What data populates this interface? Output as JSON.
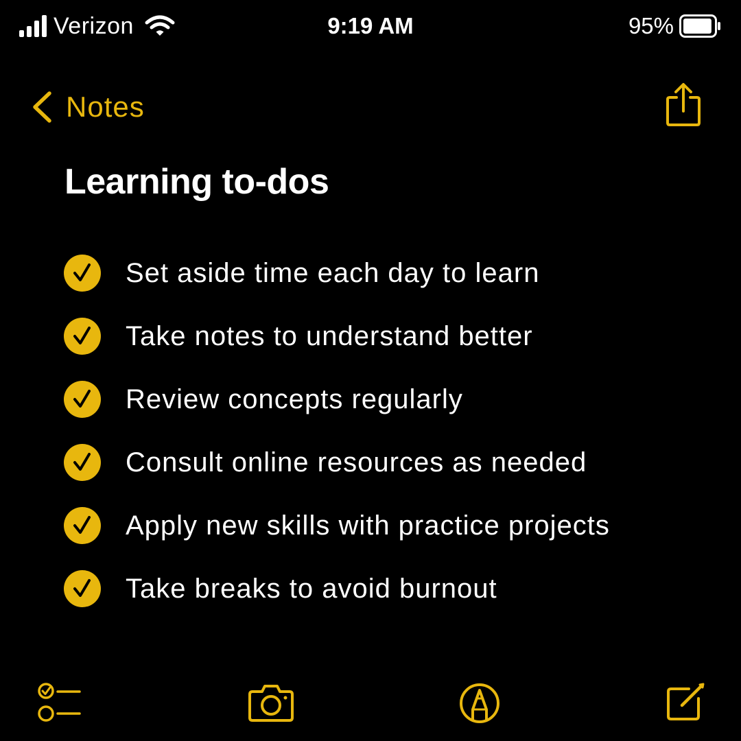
{
  "status_bar": {
    "carrier": "Verizon",
    "time": "9:19 AM",
    "battery_percent": "95%",
    "battery_level": 0.95,
    "signal_bars": 4,
    "icons": [
      "signal-icon",
      "wifi-icon",
      "battery-icon"
    ]
  },
  "nav": {
    "back_label": "Notes",
    "icons": [
      "chevron-left-icon",
      "share-icon"
    ]
  },
  "note": {
    "title": "Learning to-dos",
    "items": [
      {
        "text": "Set aside time each day to learn",
        "checked": true
      },
      {
        "text": "Take notes to understand better",
        "checked": true
      },
      {
        "text": "Review concepts regularly",
        "checked": true
      },
      {
        "text": "Consult online resources as needed",
        "checked": true
      },
      {
        "text": "Apply new skills with practice projects",
        "checked": true
      },
      {
        "text": "Take breaks to avoid burnout",
        "checked": true
      }
    ]
  },
  "toolbar": {
    "icons": [
      "checklist-icon",
      "camera-icon",
      "markup-pen-icon",
      "compose-icon"
    ]
  },
  "colors": {
    "accent": "#E8B70E",
    "background": "#000000",
    "text": "#FFFFFF"
  }
}
